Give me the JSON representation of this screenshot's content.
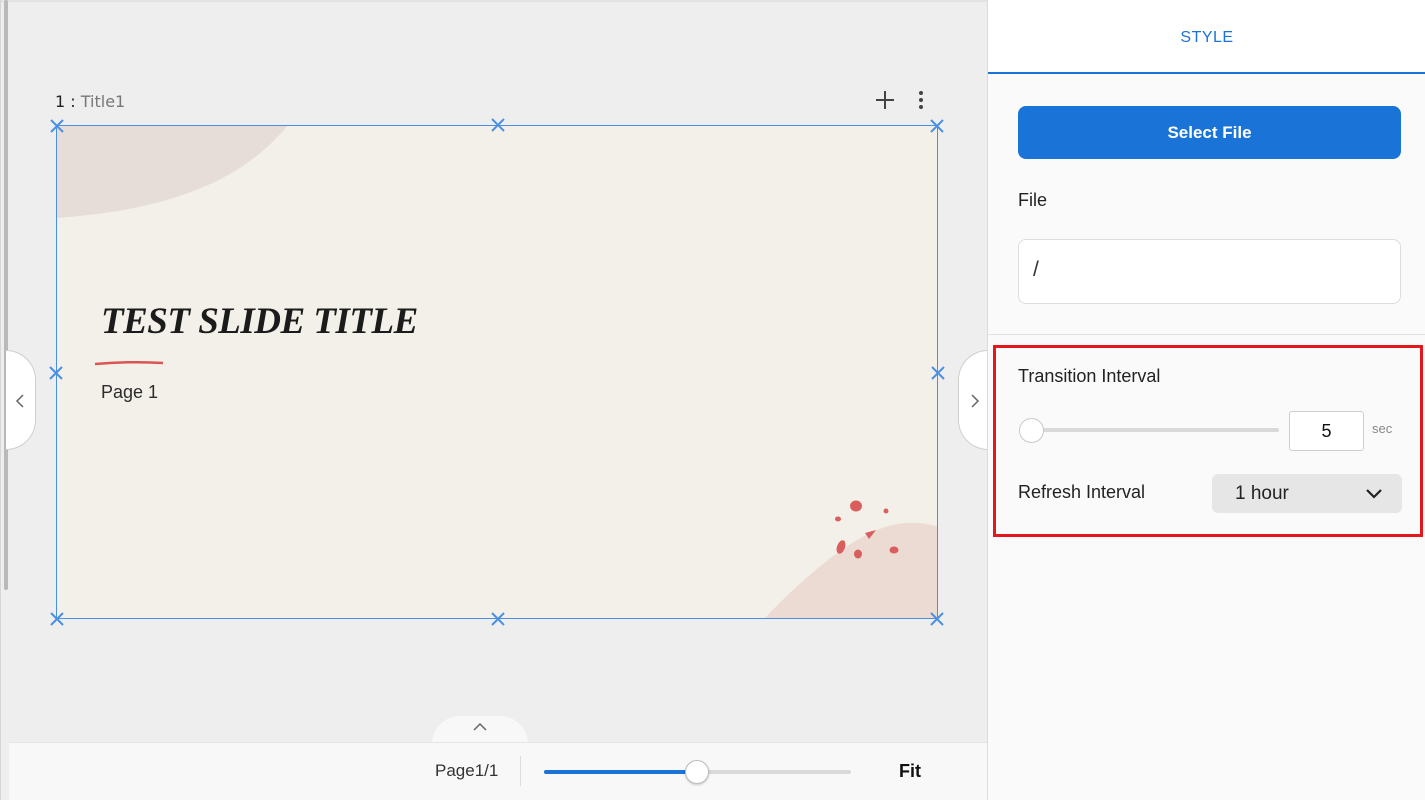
{
  "slide": {
    "number": "1",
    "separator": ":",
    "name": "Title1",
    "title": "TEST SLIDE TITLE",
    "subtitle": "Page 1"
  },
  "bottom_bar": {
    "page_label": "Page",
    "page_value": "1/1",
    "zoom_fraction": 0.5,
    "fit_label": "Fit"
  },
  "panel": {
    "tab_label": "STYLE",
    "select_file_label": "Select File",
    "file_label": "File",
    "file_value": "/",
    "transition_label": "Transition Interval",
    "transition_value": "5",
    "transition_unit": "sec",
    "refresh_label": "Refresh Interval",
    "refresh_value": "1 hour"
  },
  "colors": {
    "accent": "#1a73d6",
    "selection": "#4a90e2",
    "highlight": "#e3171e"
  },
  "icons": [
    "plus-icon",
    "more-vertical-icon",
    "chevron-left-icon",
    "chevron-right-icon",
    "chevron-up-icon",
    "chevron-down-icon"
  ]
}
